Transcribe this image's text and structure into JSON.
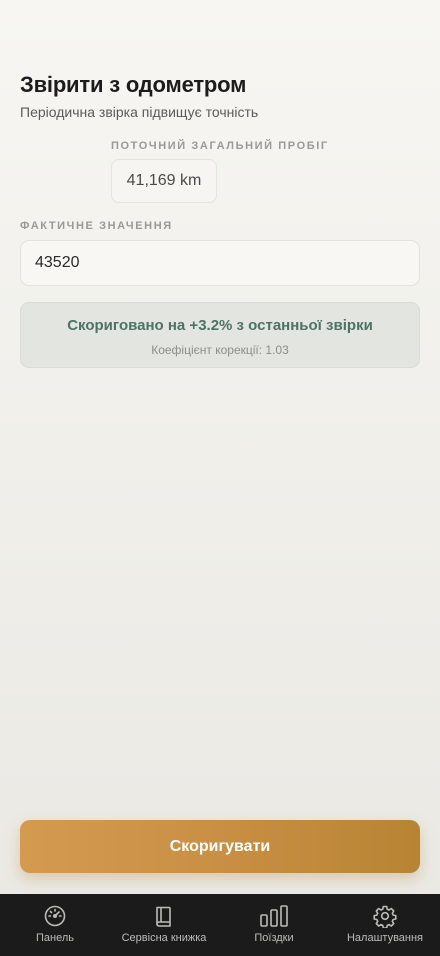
{
  "header": {
    "title": "Звірити з одометром",
    "subtitle": "Періодична звірка підвищує точність"
  },
  "current_mileage": {
    "label": "ПОТОЧНИЙ ЗАГАЛЬНИЙ ПРОБІГ",
    "value": "41,169 km"
  },
  "actual_value": {
    "label": "ФАКТИЧНЕ ЗНАЧЕННЯ",
    "value": "43520"
  },
  "info": {
    "main": "Скориговано на +3.2% з останньої звірки",
    "sub": "Коефіцієнт корекції: 1.03"
  },
  "cta": {
    "label": "Скоригувати"
  },
  "tabbar": {
    "items": [
      {
        "label": "Панель",
        "icon": "gauge-icon"
      },
      {
        "label": "Сервісна книжка",
        "icon": "book-icon"
      },
      {
        "label": "Поїздки",
        "icon": "bar-chart-icon"
      },
      {
        "label": "Налаштування",
        "icon": "gear-icon"
      }
    ]
  },
  "colors": {
    "accent": "#c98f44",
    "info_text": "#4d7266",
    "tabbar_bg": "#1b1b1b"
  }
}
